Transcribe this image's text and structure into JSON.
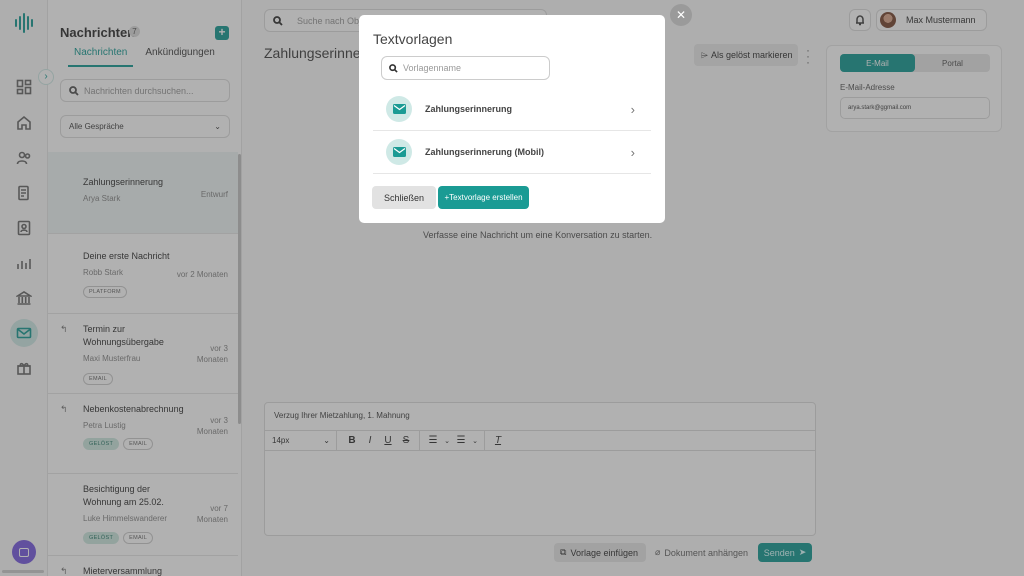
{
  "panel": {
    "title": "Nachrichten",
    "count": "7",
    "add_label": "+",
    "tabs": [
      "Nachrichten",
      "Ankündigungen"
    ],
    "search_placeholder": "Nachrichten durchsuchen...",
    "filter_value": "Alle Gespräche"
  },
  "conversations": [
    {
      "title": "Zahlungserinnerung",
      "author": "Arya Stark",
      "time": "Entwurf",
      "tags": []
    },
    {
      "title": "Deine erste Nachricht",
      "author": "Robb Stark",
      "time": "vor 2 Monaten",
      "tags": [
        "PLATFORM"
      ]
    },
    {
      "title": "Termin zur Wohnungsübergabe",
      "author": "Maxi Musterfrau",
      "time_l1": "vor 3",
      "time_l2": "Monaten",
      "tags": [
        "EMAIL"
      ]
    },
    {
      "title": "Nebenkostenabrechnung",
      "author": "Petra Lustig",
      "time_l1": "vor 3",
      "time_l2": "Monaten",
      "tags": [
        "GELÖST",
        "EMAIL"
      ]
    },
    {
      "title": "Besichtigung der Wohnung am 25.02.",
      "author": "Luke Himmelswanderer",
      "time_l1": "vor 7",
      "time_l2": "Monaten",
      "tags": [
        "GELÖST",
        "EMAIL"
      ]
    },
    {
      "title": "Mieterversammlung"
    }
  ],
  "topbar": {
    "search_placeholder": "Suche nach Objekten...",
    "user_name": "Max Mustermann"
  },
  "main": {
    "conversation_title": "Zahlungserinnerung",
    "resolve_label": "Als gelöst markieren",
    "empty_text": "Verfasse eine Nachricht um eine Konversation zu starten.",
    "channel_tabs": [
      "E-Mail",
      "Portal"
    ],
    "email_label": "E-Mail-Adresse",
    "email_value": "arya.stark@ggmail.com"
  },
  "composer": {
    "subject": "Verzug Ihrer Mietzahlung, 1. Mahnung",
    "font_size": "14px",
    "insert_label": "Vorlage einfügen",
    "attach_label": "Dokument anhängen",
    "send_label": "Senden"
  },
  "modal": {
    "title": "Textvorlagen",
    "search_placeholder": "Vorlagenname",
    "templates": [
      "Zahlungserinnerung",
      "Zahlungserinnerung (Mobil)"
    ],
    "close_label": "Schließen",
    "create_label": "+Textvorlage erstellen"
  },
  "colors": {
    "accent": "#1a9b94",
    "accent_light": "#cfe9e6",
    "overlay": "rgba(60,60,60,0.40)"
  }
}
